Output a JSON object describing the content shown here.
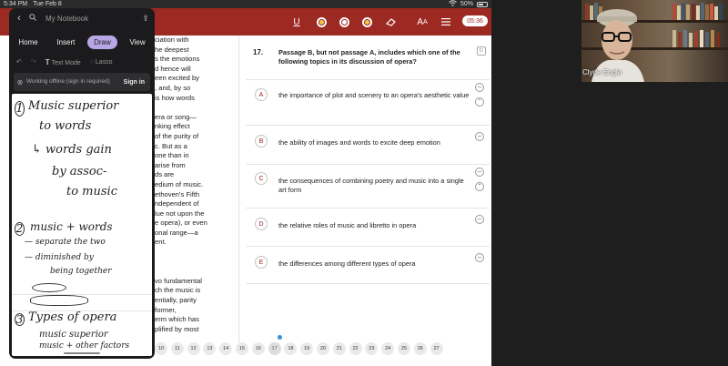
{
  "status_bar": {
    "time": "5:34 PM",
    "date": "Tue Feb 8",
    "battery": "50%"
  },
  "app": {
    "timer": "05:36",
    "question": {
      "number": "17.",
      "text": "Passage B, but not passage A, includes which one of the following topics in its discussion of opera?",
      "options": [
        {
          "letter": "A",
          "text": "the importance of plot and scenery to an opera's aesthetic value"
        },
        {
          "letter": "B",
          "text": "the ability of images and words to excite deep emotion"
        },
        {
          "letter": "C",
          "text": "the consequences of combining poetry and music into a single art form"
        },
        {
          "letter": "D",
          "text": "the relative roles of music and libretto in opera"
        },
        {
          "letter": "E",
          "text": "the differences among different types of opera"
        }
      ]
    },
    "passage_lines": [
      "ciation with",
      "he deepest",
      "s the emotions",
      "d hence will",
      "een excited by",
      ", and, by so",
      "is how words",
      "",
      "era or song—",
      "nking effect",
      "of the purity of",
      "c. But as a",
      "one than in",
      "arise from",
      "ds are",
      "edium of music.",
      "ethoven's Fifth",
      "ndependent of",
      "lue not upon the",
      "e opera), or even",
      "onal range—a",
      "ent.",
      "",
      "",
      "",
      "vo fundamental",
      "ch the music is",
      "entially, parity",
      "former,",
      "erm which has",
      "plified by most"
    ],
    "nav_pages": [
      "10",
      "11",
      "12",
      "13",
      "14",
      "15",
      "16",
      "17",
      "18",
      "19",
      "20",
      "21",
      "22",
      "23",
      "24",
      "25",
      "26",
      "27"
    ],
    "current_page": "17"
  },
  "notebook": {
    "title": "My Notebook",
    "tabs": [
      "Home",
      "Insert",
      "Draw",
      "View"
    ],
    "active_tab": "Draw",
    "tools": {
      "text_mode": "Text Mode",
      "lasso": "Lasso"
    },
    "status": {
      "message": "Working offline (sign in required)",
      "action": "Sign in"
    },
    "handwriting": {
      "n1": "1",
      "l1": "Music superior",
      "l2": "to words",
      "l3": "↳ words gain",
      "l4": "by assoc-",
      "l5": "to music",
      "n2": "2",
      "l6": "music + words",
      "l7": "— separate the two",
      "l8": "— diminished by",
      "l9": "being together",
      "n3": "3",
      "l10": "Types of opera",
      "l11": "music superior",
      "l12": "music + other factors"
    }
  },
  "video": {
    "participant": "Clyde Engle"
  },
  "colors": {
    "brand_red": "#9d2a22",
    "notebook_accent": "#b8a6e6",
    "toggle_yellow": "#f3c84a",
    "current_marker": "#3a8fd6"
  }
}
